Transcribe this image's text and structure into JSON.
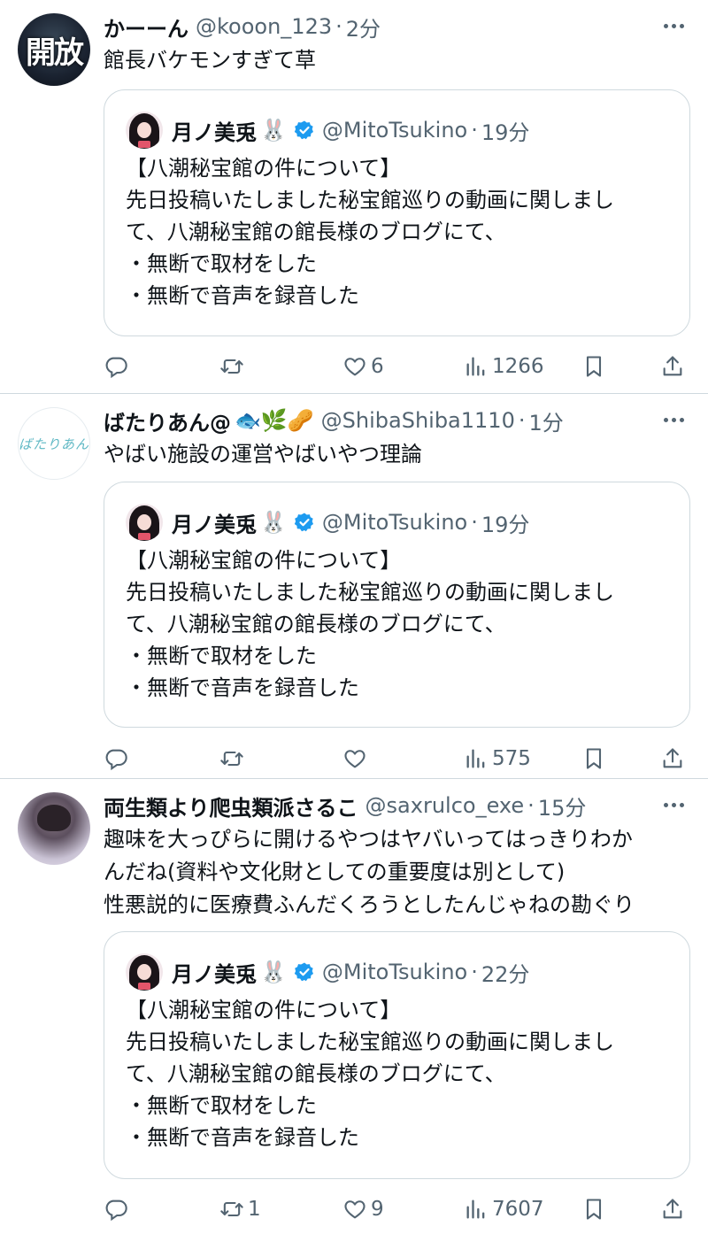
{
  "tweets": [
    {
      "avatar_text": "開放",
      "name": "かーーん",
      "name_emoji": "",
      "handle": "@kooon_123",
      "time": "2分",
      "text": "館長バケモンすぎて草",
      "quote": {
        "name": "月ノ美兎",
        "emoji": "🐰",
        "handle": "@MitoTsukino",
        "time": "19分",
        "lines": [
          "【八潮秘宝館の件について】",
          "先日投稿いたしました秘宝館巡りの動画に関しまし",
          "て、八潮秘宝館の館長様のブログにて、",
          "・無断で取材をした",
          "・無断で音声を録音した"
        ]
      },
      "counts": {
        "reply": "",
        "retweet": "",
        "like": "6",
        "views": "1266"
      }
    },
    {
      "avatar_text": "ばたりあん",
      "name": "ばたりあん@",
      "name_emoji": "🐟🌿🥜",
      "handle": "@ShibaShiba1110",
      "time": "1分",
      "text": "やばい施設の運営やばいやつ理論",
      "quote": {
        "name": "月ノ美兎",
        "emoji": "🐰",
        "handle": "@MitoTsukino",
        "time": "19分",
        "lines": [
          "【八潮秘宝館の件について】",
          "先日投稿いたしました秘宝館巡りの動画に関しまし",
          "て、八潮秘宝館の館長様のブログにて、",
          "・無断で取材をした",
          "・無断で音声を録音した"
        ]
      },
      "counts": {
        "reply": "",
        "retweet": "",
        "like": "",
        "views": "575"
      }
    },
    {
      "avatar_text": "",
      "name": "両生類より爬虫類派さるこ",
      "name_emoji": "",
      "handle": "@saxrulco_exe",
      "time": "15分",
      "text": "趣味を大っぴらに開けるやつはヤバいってはっきりわか\nんだね(資料や文化財としての重要度は別として)\n性悪説的に医療費ふんだくろうとしたんじゃねの勘ぐり",
      "quote": {
        "name": "月ノ美兎",
        "emoji": "🐰",
        "handle": "@MitoTsukino",
        "time": "22分",
        "lines": [
          "【八潮秘宝館の件について】",
          "先日投稿いたしました秘宝館巡りの動画に関しまし",
          "て、八潮秘宝館の館長様のブログにて、",
          "・無断で取材をした",
          "・無断で音声を録音した"
        ]
      },
      "counts": {
        "reply": "",
        "retweet": "1",
        "like": "9",
        "views": "7607"
      }
    }
  ],
  "colors": {
    "text": "#0f1419",
    "muted": "#536471",
    "border": "#cfd9de",
    "verified": "#1d9bf0"
  },
  "icons": [
    "reply-icon",
    "retweet-icon",
    "like-icon",
    "views-icon",
    "bookmark-icon",
    "share-icon",
    "verified-icon",
    "more-icon"
  ]
}
